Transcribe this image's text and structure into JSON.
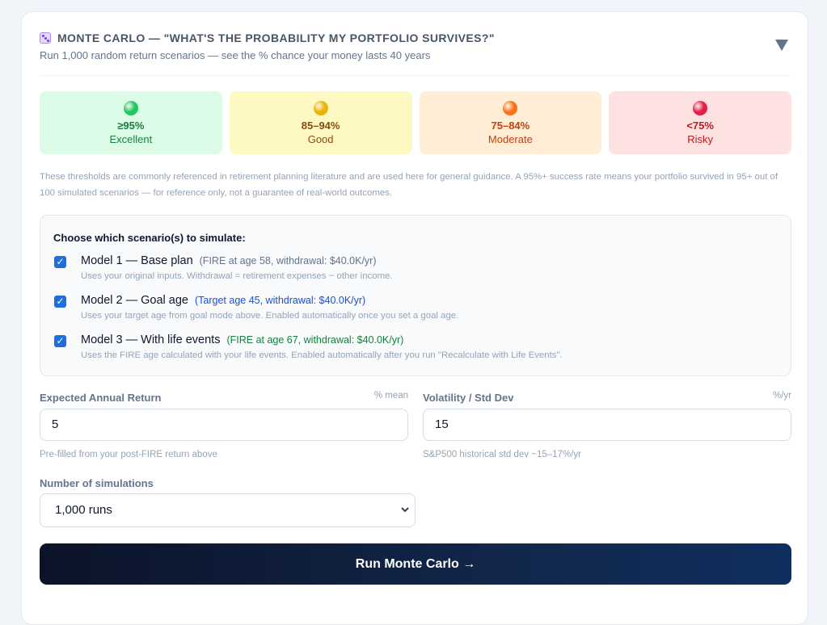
{
  "header": {
    "title": "MONTE CARLO — \"WHAT'S THE PROBABILITY MY PORTFOLIO SURVIVES?\"",
    "subtitle": "Run 1,000 random return scenarios — see the % chance your money lasts 40 years",
    "icon": "die-icon",
    "collapse_icon": "triangle-down-icon"
  },
  "tiers": [
    {
      "range": "≥95%",
      "label": "Excellent",
      "bg": "#dcfce7",
      "text": "#15803d",
      "dot": "#22c55e"
    },
    {
      "range": "85–94%",
      "label": "Good",
      "bg": "#fef9c3",
      "text": "#854d0e",
      "dot": "#eab308"
    },
    {
      "range": "75–84%",
      "label": "Moderate",
      "bg": "#ffedd5",
      "text": "#c2410c",
      "dot": "#f97316"
    },
    {
      "range": "<75%",
      "label": "Risky",
      "bg": "#fee2e2",
      "text": "#b91c1c",
      "dot": "#e11d48"
    }
  ],
  "note": "These thresholds are commonly referenced in retirement planning literature and are used here for general guidance. A 95%+ success rate means your portfolio survived in 95+ out of 100 simulated scenarios — for reference only, not a guarantee of real-world outcomes.",
  "scenarios": {
    "heading": "Choose which scenario(s) to simulate:",
    "models": [
      {
        "title": "Model 1 — Base plan",
        "detail": "(FIRE at age 58, withdrawal: $40.0K/yr)",
        "detail_color": "#64748b",
        "desc": "Uses your original inputs. Withdrawal = retirement expenses − other income.",
        "checked": true
      },
      {
        "title": "Model 2 — Goal age",
        "detail": "(Target age 45, withdrawal: $40.0K/yr)",
        "detail_color": "#1d4ed8",
        "desc": "Uses your target age from goal mode above. Enabled automatically once you set a goal age.",
        "checked": true
      },
      {
        "title": "Model 3 — With life events",
        "detail": "(FIRE at age 67, withdrawal: $40.0K/yr)",
        "detail_color": "#15803d",
        "desc": "Uses the FIRE age calculated with your life events. Enabled automatically after you run \"Recalculate with Life Events\".",
        "checked": true
      }
    ]
  },
  "inputs": {
    "return": {
      "label": "Expected Annual Return",
      "unit": "% mean",
      "value": "5",
      "help": "Pre-filled from your post-FIRE return above"
    },
    "volatility": {
      "label": "Volatility / Std Dev",
      "unit": "%/yr",
      "value": "15",
      "help": "S&P500 historical std dev ~15–17%/yr"
    },
    "simulations": {
      "label": "Number of simulations",
      "value": "1,000 runs"
    }
  },
  "run_button": {
    "label": "Run Monte Carlo →"
  }
}
